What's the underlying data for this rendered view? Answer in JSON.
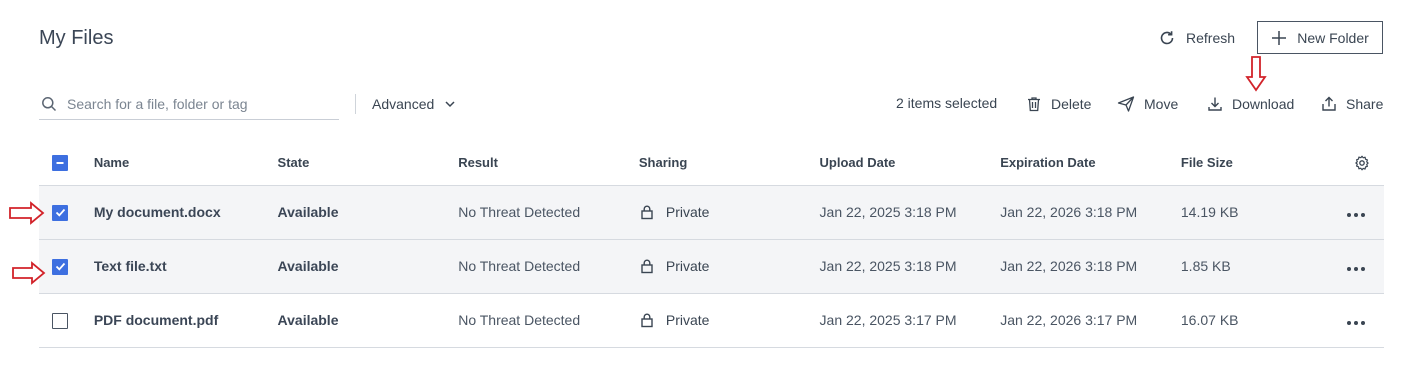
{
  "header": {
    "title": "My Files",
    "refresh_label": "Refresh",
    "new_folder_label": "New Folder"
  },
  "search": {
    "placeholder": "Search for a file, folder or tag"
  },
  "filters": {
    "advanced_label": "Advanced"
  },
  "selection": {
    "count_text": "2 items selected",
    "actions": {
      "delete": "Delete",
      "move": "Move",
      "download": "Download",
      "share": "Share"
    }
  },
  "table": {
    "columns": [
      "Name",
      "State",
      "Result",
      "Sharing",
      "Upload Date",
      "Expiration Date",
      "File Size"
    ],
    "rows": [
      {
        "selected": true,
        "name": "My document.docx",
        "state": "Available",
        "result": "No Threat Detected",
        "sharing": "Private",
        "upload_date": "Jan 22, 2025 3:18 PM",
        "expiration_date": "Jan 22, 2026 3:18 PM",
        "file_size": "14.19 KB"
      },
      {
        "selected": true,
        "name": "Text file.txt",
        "state": "Available",
        "result": "No Threat Detected",
        "sharing": "Private",
        "upload_date": "Jan 22, 2025 3:18 PM",
        "expiration_date": "Jan 22, 2026 3:18 PM",
        "file_size": "1.85 KB"
      },
      {
        "selected": false,
        "name": "PDF document.pdf",
        "state": "Available",
        "result": "No Threat Detected",
        "sharing": "Private",
        "upload_date": "Jan 22, 2025 3:17 PM",
        "expiration_date": "Jan 22, 2026 3:17 PM",
        "file_size": "16.07 KB"
      }
    ]
  },
  "annotations": {
    "arrow_color": "#d2232a"
  },
  "colors": {
    "accent": "#3d6fe0",
    "selected_row_bg": "#f4f5f7"
  }
}
